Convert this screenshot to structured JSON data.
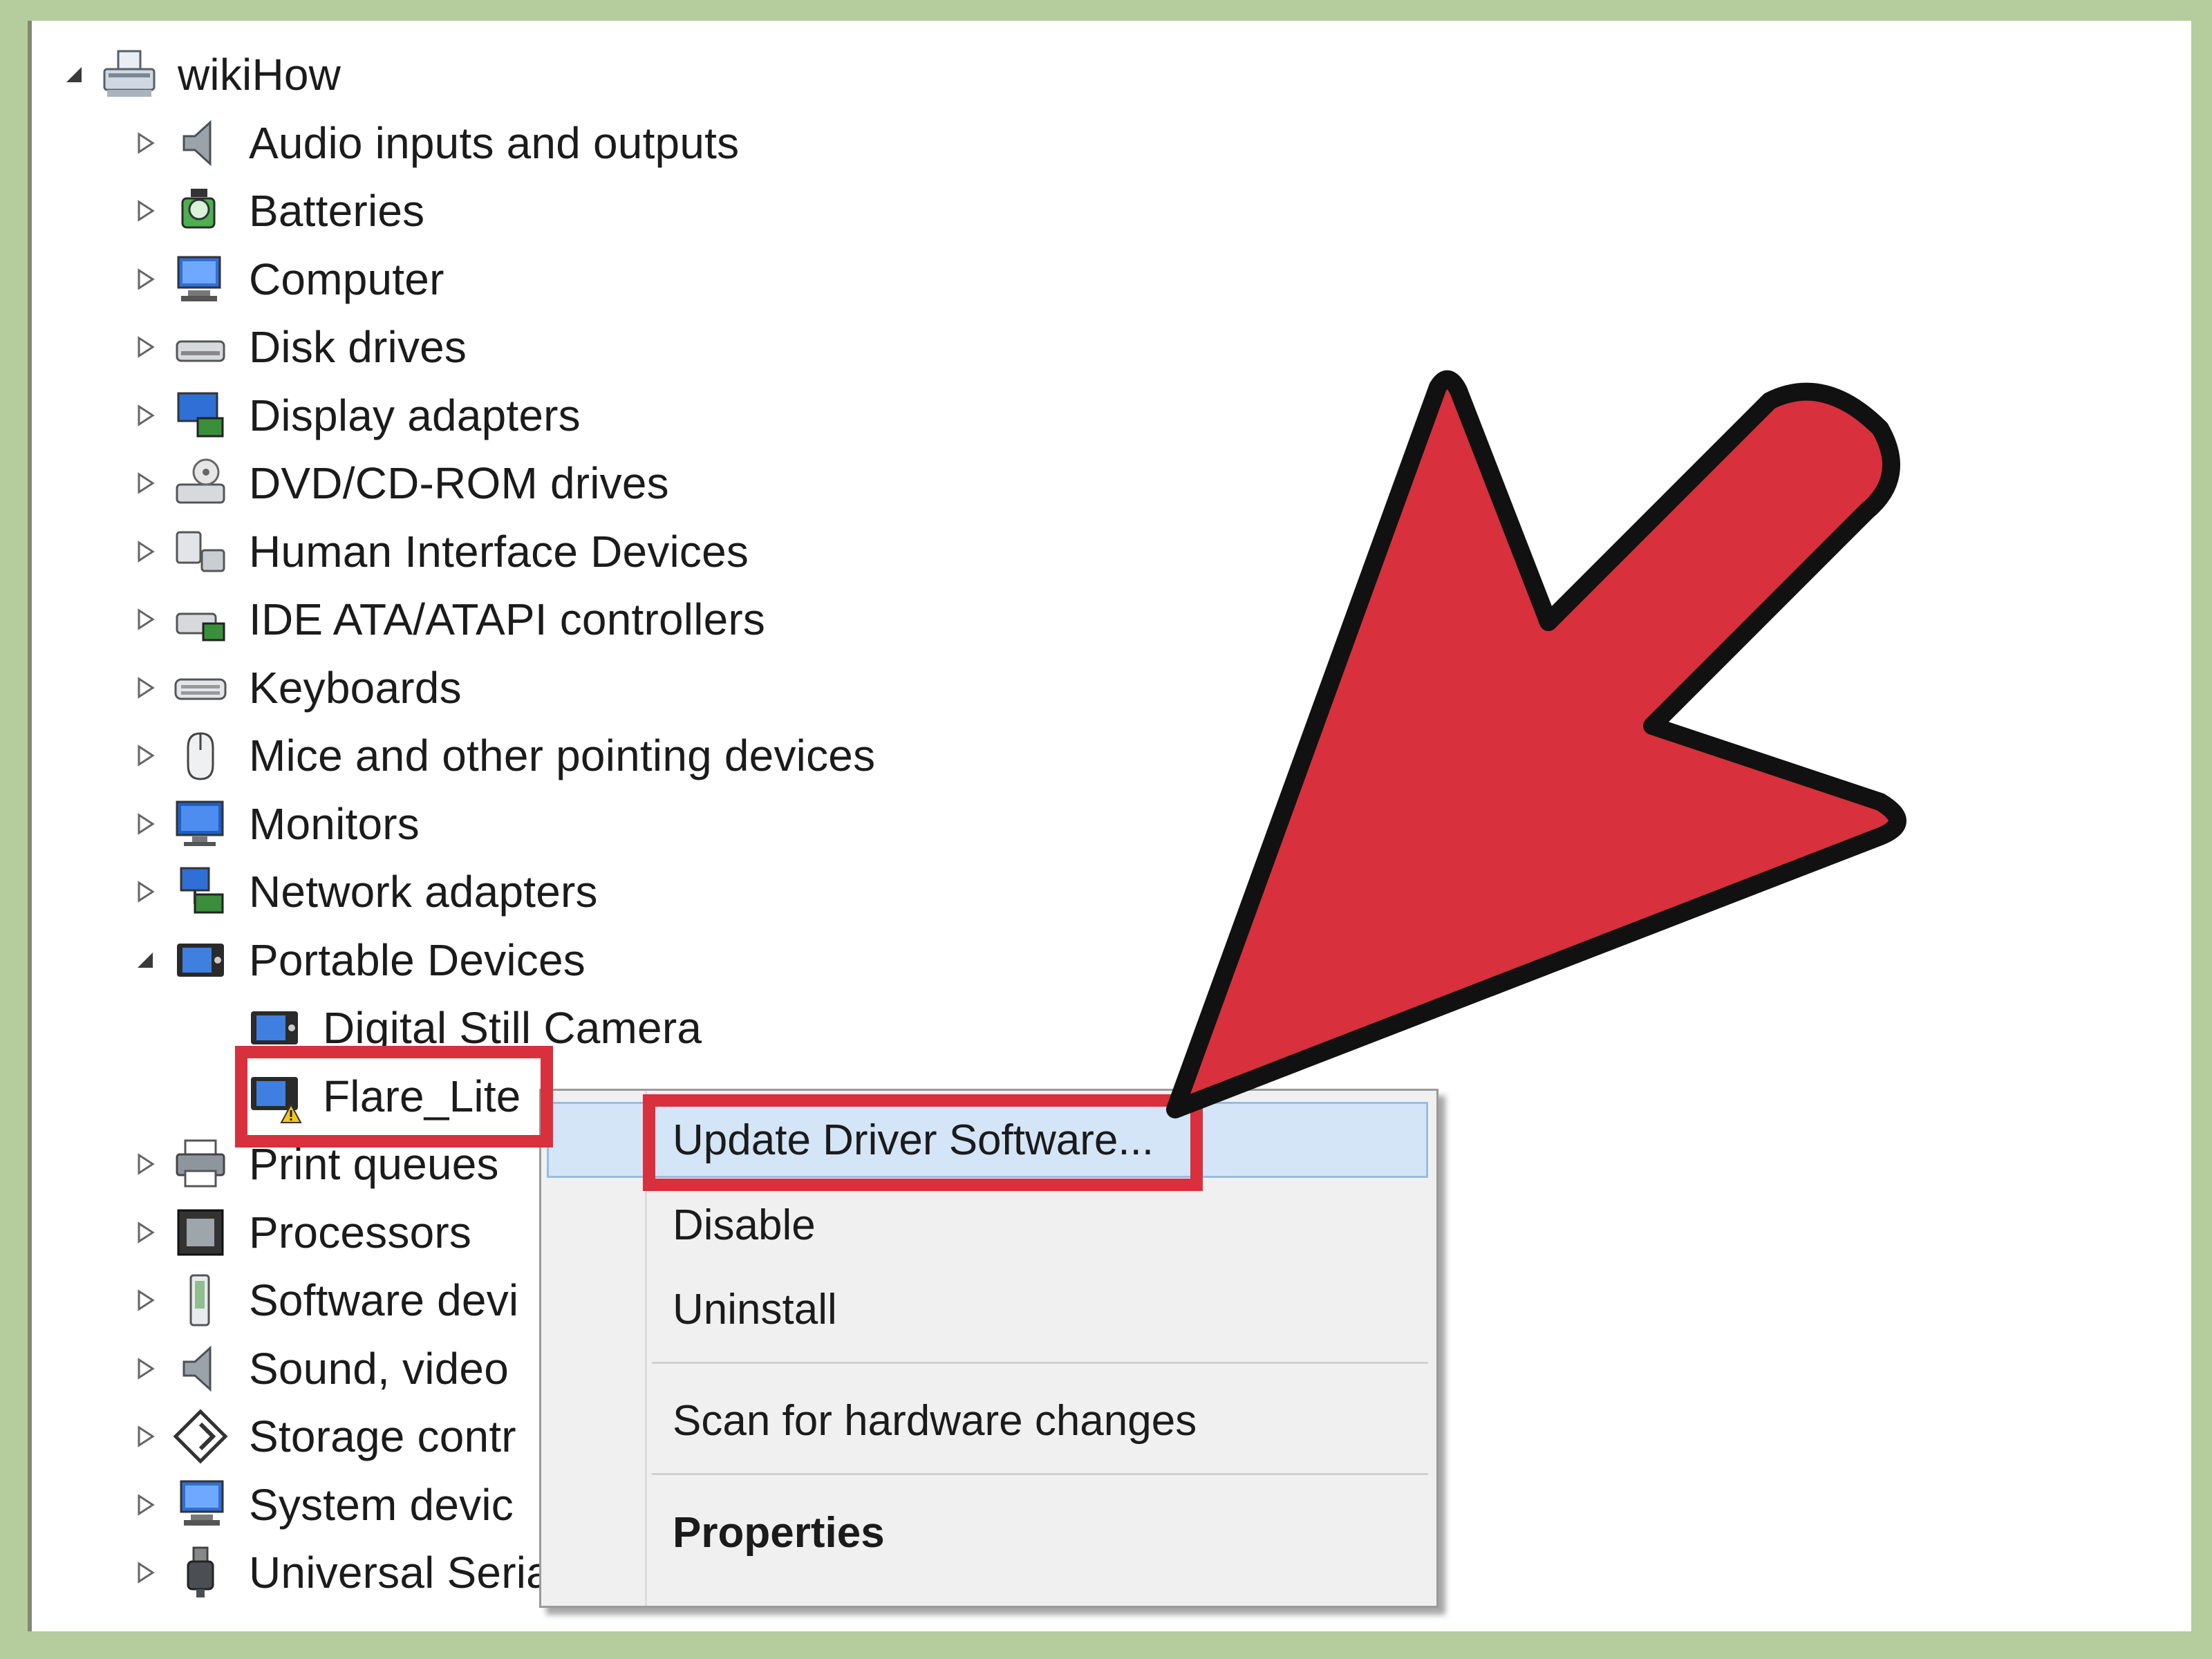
{
  "root": {
    "label": "wikiHow",
    "icon": "computer-root-icon"
  },
  "categories": [
    {
      "label": "Audio inputs and outputs",
      "icon": "speaker-icon",
      "expanded": false
    },
    {
      "label": "Batteries",
      "icon": "battery-icon",
      "expanded": false
    },
    {
      "label": "Computer",
      "icon": "computer-icon",
      "expanded": false
    },
    {
      "label": "Disk drives",
      "icon": "disk-drive-icon",
      "expanded": false
    },
    {
      "label": "Display adapters",
      "icon": "display-adapter-icon",
      "expanded": false
    },
    {
      "label": "DVD/CD-ROM drives",
      "icon": "dvd-drive-icon",
      "expanded": false
    },
    {
      "label": "Human Interface Devices",
      "icon": "hid-icon",
      "expanded": false
    },
    {
      "label": "IDE ATA/ATAPI controllers",
      "icon": "ide-controller-icon",
      "expanded": false
    },
    {
      "label": "Keyboards",
      "icon": "keyboard-icon",
      "expanded": false
    },
    {
      "label": "Mice and other pointing devices",
      "icon": "mouse-icon",
      "expanded": false
    },
    {
      "label": "Monitors",
      "icon": "monitor-icon",
      "expanded": false
    },
    {
      "label": "Network adapters",
      "icon": "network-adapter-icon",
      "expanded": false
    },
    {
      "label": "Portable Devices",
      "icon": "portable-device-icon",
      "expanded": true,
      "children": [
        {
          "label": "Digital Still Camera",
          "icon": "portable-device-icon",
          "warning": false
        },
        {
          "label": "Flare_Lite",
          "icon": "portable-device-warning-icon",
          "warning": true
        }
      ]
    },
    {
      "label": "Print queues",
      "icon": "printer-icon",
      "expanded": false
    },
    {
      "label": "Processors",
      "icon": "processor-icon",
      "expanded": false
    },
    {
      "label": "Software devi",
      "icon": "software-device-icon",
      "expanded": false
    },
    {
      "label": "Sound, video",
      "icon": "sound-icon",
      "expanded": false
    },
    {
      "label": "Storage contr",
      "icon": "storage-controller-icon",
      "expanded": false
    },
    {
      "label": "System devic",
      "icon": "system-device-icon",
      "expanded": false
    },
    {
      "label": "Universal Serial Bus controllers",
      "icon": "usb-icon",
      "expanded": false
    }
  ],
  "context_menu": {
    "items": [
      {
        "label": "Update Driver Software...",
        "highlighted": true,
        "bold": false
      },
      {
        "label": "Disable",
        "highlighted": false,
        "bold": false
      },
      {
        "label": "Uninstall",
        "highlighted": false,
        "bold": false
      },
      {
        "label": "Scan for hardware changes",
        "highlighted": false,
        "bold": false
      },
      {
        "label": "Properties",
        "highlighted": false,
        "bold": true
      }
    ]
  },
  "colors": {
    "frame": "#b5cc9d",
    "annotation_red": "#d8303c",
    "menu_highlight": "#d3e5f7",
    "menu_background": "#f0f0f0"
  }
}
